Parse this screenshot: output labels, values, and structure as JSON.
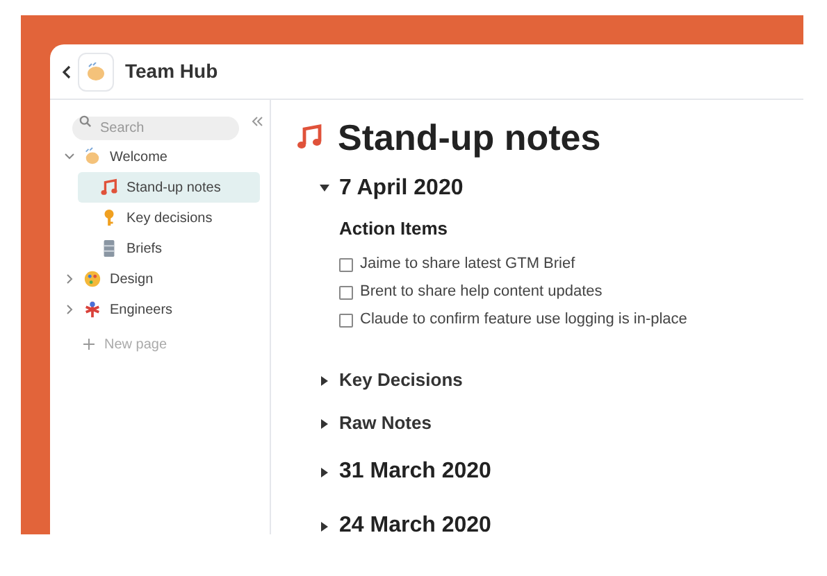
{
  "header": {
    "title": "Team Hub"
  },
  "sidebar": {
    "search": {
      "placeholder": "Search"
    },
    "items": [
      {
        "label": "Welcome",
        "expanded": true,
        "children": [
          {
            "label": "Stand-up notes",
            "selected": true
          },
          {
            "label": "Key decisions",
            "selected": false
          },
          {
            "label": "Briefs",
            "selected": false
          }
        ]
      },
      {
        "label": "Design",
        "expanded": false
      },
      {
        "label": "Engineers",
        "expanded": false
      }
    ],
    "new_page": "New page"
  },
  "page": {
    "title": "Stand-up notes",
    "toggles": [
      {
        "kind": "date",
        "label": "7 April 2020",
        "expanded": true,
        "heading": "Action Items",
        "tasks": [
          {
            "label": "Jaime to share latest GTM Brief",
            "checked": false
          },
          {
            "label": "Brent to share help content updates",
            "checked": false
          },
          {
            "label": "Claude to confirm feature use logging is in-place",
            "checked": false
          }
        ]
      },
      {
        "kind": "section",
        "label": "Key Decisions",
        "expanded": false
      },
      {
        "kind": "section",
        "label": "Raw Notes",
        "expanded": false
      },
      {
        "kind": "date",
        "label": "31 March 2020",
        "expanded": false
      },
      {
        "kind": "date",
        "label": "24 March 2020",
        "expanded": false
      }
    ]
  }
}
